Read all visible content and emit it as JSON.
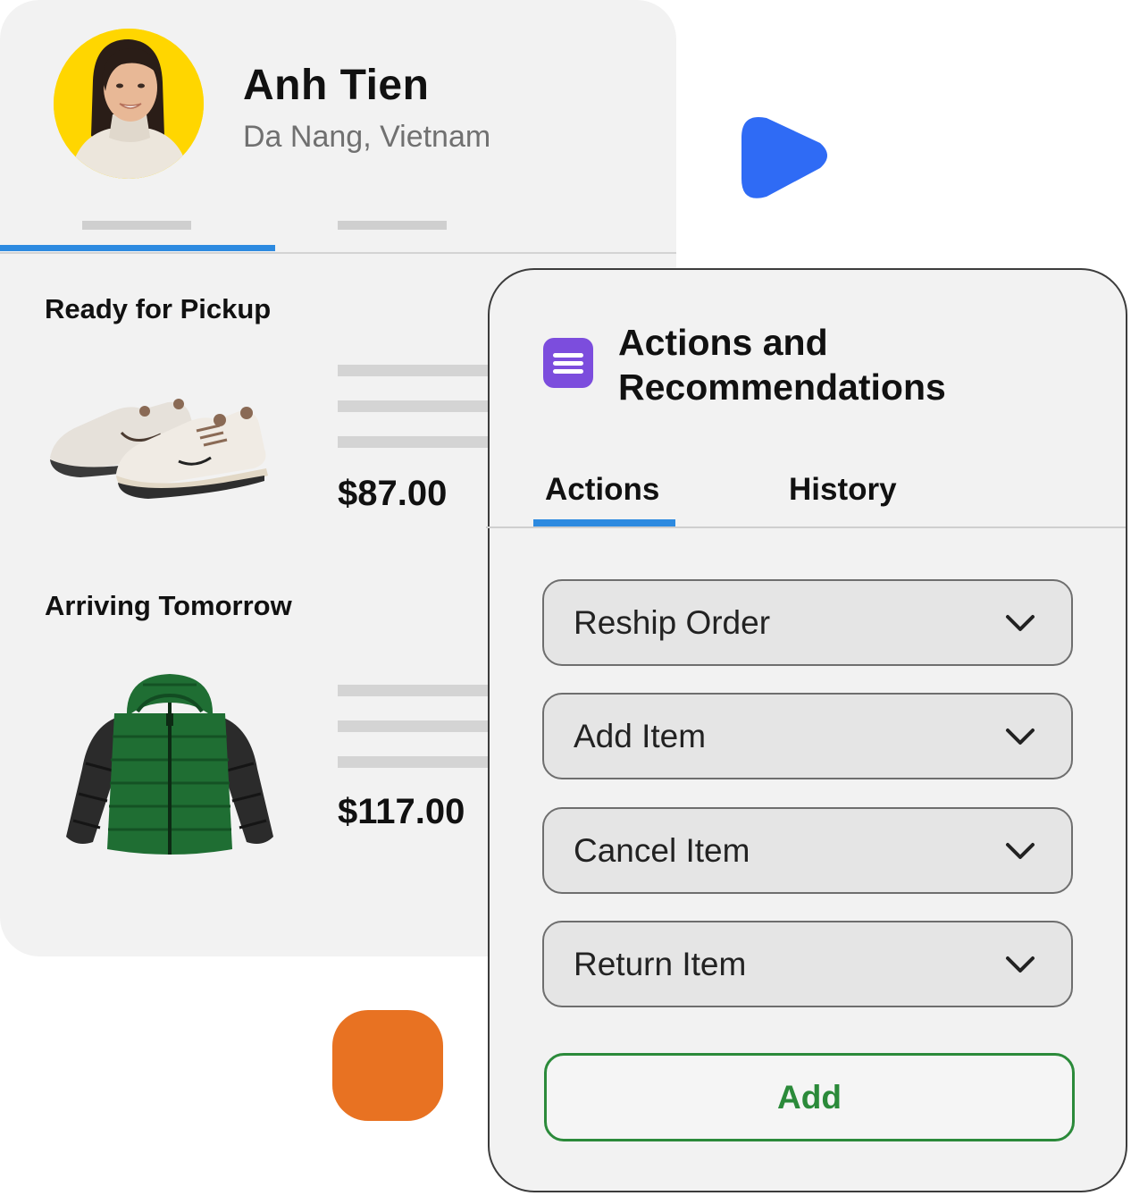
{
  "customer": {
    "name": "Anh Tien",
    "location": "Da Nang, Vietnam",
    "avatar_icon": "customer-photo"
  },
  "orders": {
    "sections": [
      {
        "title": "Ready for Pickup",
        "price": "$87.00",
        "item_icon": "sneakers-image"
      },
      {
        "title": "Arriving Tomorrow",
        "price": "$117.00",
        "item_icon": "puffer-jacket-image"
      }
    ]
  },
  "panel": {
    "title": "Actions and Recommendations",
    "icon": "menu-lines-icon",
    "tabs": [
      {
        "label": "Actions",
        "active": true
      },
      {
        "label": "History",
        "active": false
      }
    ],
    "actions": [
      {
        "label": "Reship Order"
      },
      {
        "label": "Add Item"
      },
      {
        "label": "Cancel Item"
      },
      {
        "label": "Return Item"
      }
    ],
    "add_label": "Add"
  },
  "colors": {
    "accent_blue": "#2d8ae0",
    "play_blue": "#2f6bf5",
    "purple": "#7c4ddd",
    "orange": "#e87222",
    "green": "#2b8a3a",
    "avatar_yellow": "#ffd600"
  }
}
